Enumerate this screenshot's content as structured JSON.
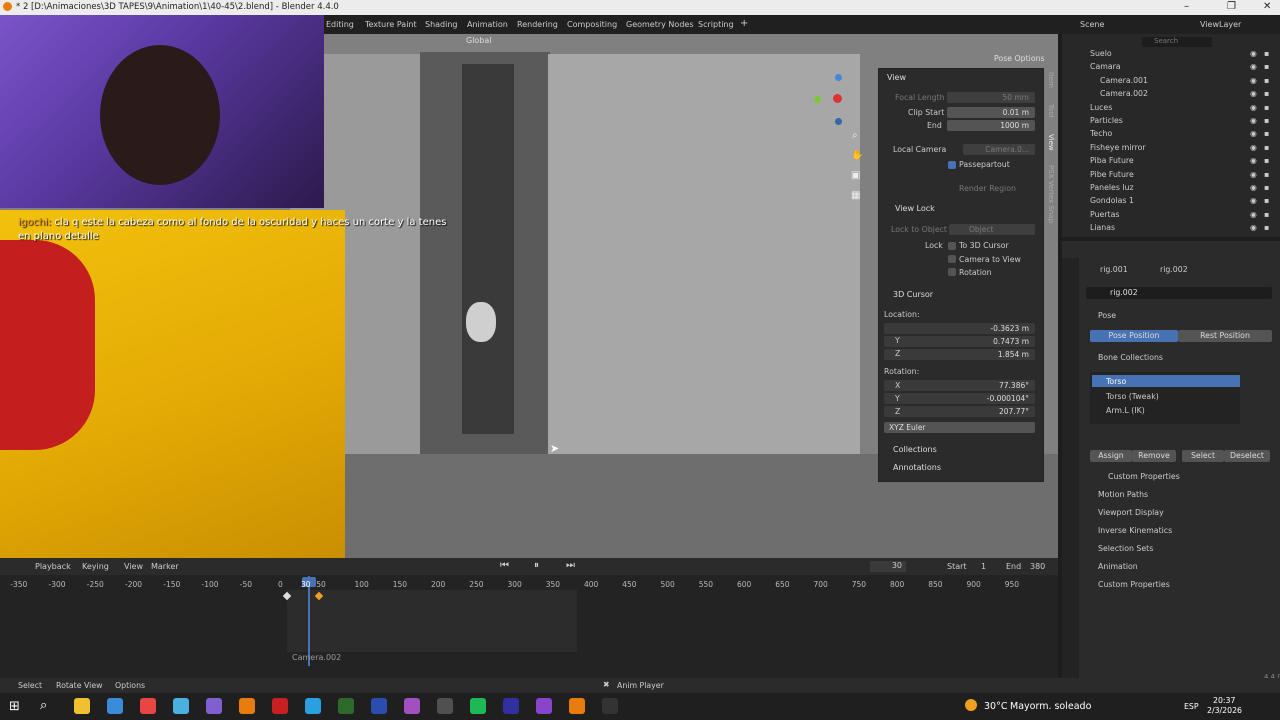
{
  "window": {
    "title": "* 2 [D:\\Animaciones\\3D TAPES\\9\\Animation\\1\\40-45\\2.blend] - Blender 4.4.0"
  },
  "workspaces": [
    "Editing",
    "Texture Paint",
    "Shading",
    "Animation",
    "Rendering",
    "Compositing",
    "Geometry Nodes",
    "Scripting"
  ],
  "viewport": {
    "orientation": "Global",
    "pose_options": "Pose Options"
  },
  "chat": {
    "user": "igochi:",
    "message": "cla q este la cabeza como al fondo de la oscuridad y haces un corte y la tenes en plano detalle"
  },
  "npanel": {
    "view_header": "View",
    "focal_length_label": "Focal Length",
    "focal_length": "50 mm",
    "clip_start_label": "Clip Start",
    "clip_start": "0.01 m",
    "end_label": "End",
    "clip_end": "1000 m",
    "local_camera_label": "Local Camera",
    "local_camera_value": "Camera.0...",
    "passepartout": "Passepartout",
    "render_region": "Render Region",
    "view_lock_header": "View Lock",
    "lock_to_object_label": "Lock to Object",
    "lock_object_placeholder": "Object",
    "lock_label": "Lock",
    "to_3d_cursor": "To 3D Cursor",
    "camera_to_view": "Camera to View",
    "rotation_opt": "Rotation",
    "cursor_header": "3D Cursor",
    "location_label": "Location:",
    "loc_x": "-0.3623 m",
    "loc_y": "0.7473 m",
    "loc_z": "1.854 m",
    "rotation_label": "Rotation:",
    "rot_x": "77.386°",
    "rot_y": "-0.000104°",
    "rot_z": "207.77°",
    "rotation_mode": "XYZ Euler",
    "collections": "Collections",
    "annotations": "Annotations",
    "x": "X",
    "y": "Y",
    "z": "Z"
  },
  "side_tabs": [
    "Item",
    "Tool",
    "View",
    "PSX Vertex Snap"
  ],
  "outliner": {
    "scene": "Scene",
    "view_layer": "ViewLayer",
    "search_placeholder": "Search",
    "items": [
      {
        "name": "Suelo",
        "indent": 1
      },
      {
        "name": "Camara",
        "indent": 1
      },
      {
        "name": "Camera.001",
        "indent": 2
      },
      {
        "name": "Camera.002",
        "indent": 2
      },
      {
        "name": "Luces",
        "indent": 1
      },
      {
        "name": "Particles",
        "indent": 1
      },
      {
        "name": "Techo",
        "indent": 1
      },
      {
        "name": "Fisheye mirror",
        "indent": 1
      },
      {
        "name": "Piba Future",
        "indent": 1
      },
      {
        "name": "Pibe Future",
        "indent": 1
      },
      {
        "name": "Paneles luz",
        "indent": 1
      },
      {
        "name": "Gondolas 1",
        "indent": 1
      },
      {
        "name": "Puertas",
        "indent": 1
      },
      {
        "name": "Lianas",
        "indent": 1
      }
    ]
  },
  "properties": {
    "breadcrumb_1": "rig.001",
    "breadcrumb_2": "rig.002",
    "object_name": "rig.002",
    "pose_section": "Pose",
    "pose_position": "Pose Position",
    "rest_position": "Rest Position",
    "bone_collections": "Bone Collections",
    "bones": [
      "Torso",
      "Torso (Tweak)",
      "Arm.L (IK)"
    ],
    "assign": "Assign",
    "remove": "Remove",
    "select": "Select",
    "deselect": "Deselect",
    "custom_properties_inner": "Custom Properties",
    "sections": [
      "Motion Paths",
      "Viewport Display",
      "Inverse Kinematics",
      "Selection Sets",
      "Animation",
      "Custom Properties"
    ]
  },
  "timeline": {
    "playback": "Playback",
    "keying": "Keying",
    "view": "View",
    "marker": "Marker",
    "current_frame": "30",
    "start_label": "Start",
    "start": "1",
    "end_label": "End",
    "end": "380",
    "ticks": [
      "-350",
      "-300",
      "-250",
      "-200",
      "-150",
      "-100",
      "-50",
      "0",
      "30",
      "50",
      "100",
      "150",
      "200",
      "250",
      "300",
      "350",
      "400",
      "450",
      "500",
      "550",
      "600",
      "650",
      "700",
      "750",
      "800",
      "850",
      "900",
      "950"
    ],
    "camera_marker": "Camera.002"
  },
  "status": {
    "select": "Select",
    "rotate_view": "Rotate View",
    "options": "Options",
    "anim_player": "Anim Player",
    "version": "4.4.0"
  },
  "taskbar": {
    "weather_temp": "30°C",
    "weather_desc": "Mayorm. soleado",
    "lang": "ESP",
    "time": "20:37",
    "date": "2/3/2026"
  },
  "colors": {
    "accent": "#4772b3",
    "viewport_bg": "#808080",
    "panel_bg": "#2b2b2b",
    "chip_yellow": "#f2c10c"
  }
}
